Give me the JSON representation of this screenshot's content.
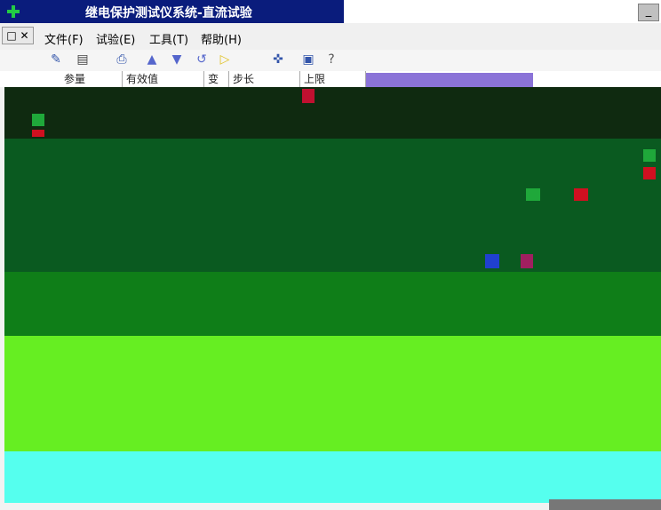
{
  "window": {
    "title": "继电保护测试仪系统-直流试验",
    "minimize_label": "_"
  },
  "menu": {
    "doc_control_label": "□ ✕",
    "items": [
      {
        "label": "文件(F)"
      },
      {
        "label": "试验(E)"
      },
      {
        "label": "工具(T)"
      },
      {
        "label": "帮助(H)"
      }
    ]
  },
  "toolbar": {
    "icons": [
      "open-icon",
      "save-icon",
      "print-icon",
      "up-arrow-icon",
      "down-arrow-icon",
      "undo-icon",
      "play-icon",
      "cursor-icon",
      "monitor-icon",
      "help-icon"
    ]
  },
  "table_header": {
    "columns": [
      "参量",
      "有效值",
      "变",
      "步长",
      "上限"
    ]
  },
  "colors": {
    "titlebar": "#0a1c7c",
    "dark_block": "#0f2a10",
    "green_block": "#0a5a20",
    "mid_green": "#0f7e18",
    "lime": "#66ee22",
    "cyan": "#55ffee",
    "purple": "#8b73d8"
  }
}
